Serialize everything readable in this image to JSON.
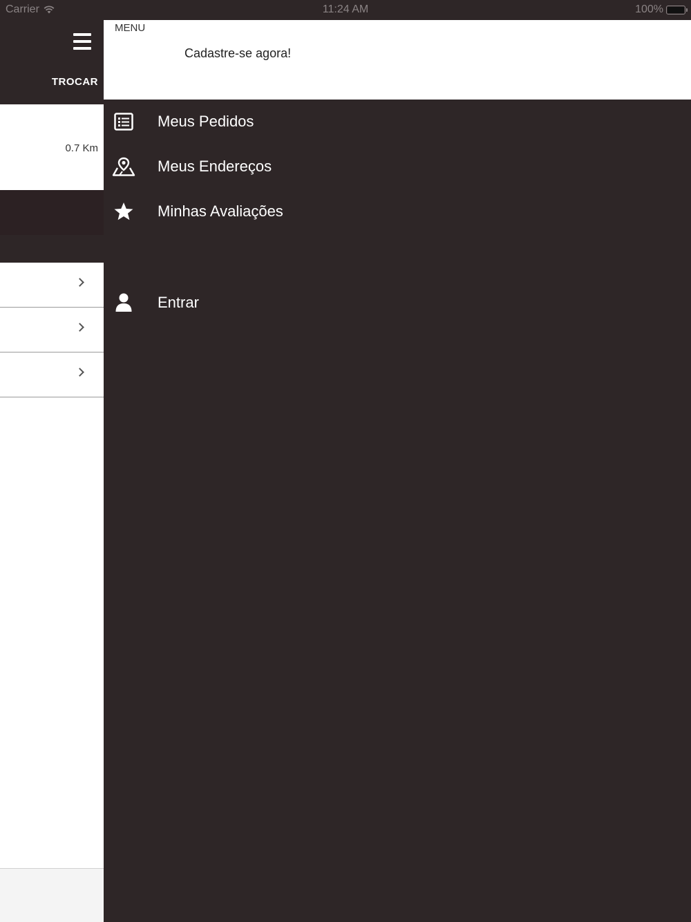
{
  "status_bar": {
    "carrier": "Carrier",
    "time": "11:24 AM",
    "battery": "100%"
  },
  "left_panel": {
    "change_button": "TROCAR",
    "distance": "0.7 Km",
    "rows": [
      "",
      "",
      ""
    ]
  },
  "menu": {
    "title": "MENU",
    "signup_link": "Cadastre-se agora!",
    "items": [
      {
        "label": "Meus Pedidos",
        "icon": "list-icon"
      },
      {
        "label": "Meus Endereços",
        "icon": "map-pin-icon"
      },
      {
        "label": "Minhas Avaliações",
        "icon": "star-icon"
      }
    ],
    "login": {
      "label": "Entrar",
      "icon": "user-icon"
    }
  },
  "colors": {
    "drawer_bg": "#2e2627",
    "header_bg": "#ffffff",
    "text_on_dark": "#ffffff"
  }
}
